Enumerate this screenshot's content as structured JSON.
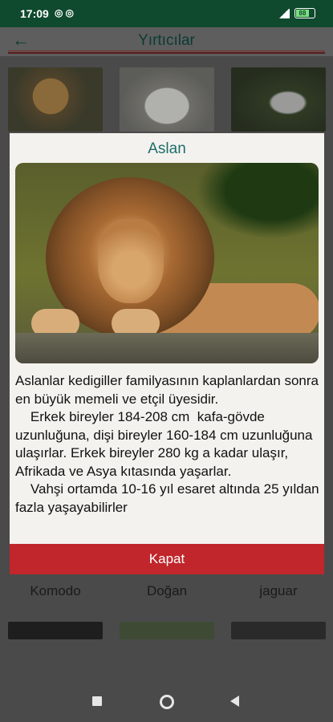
{
  "status_bar": {
    "time": "17:09",
    "notification_icons": [
      "whatsapp-icon",
      "whatsapp-icon"
    ],
    "battery": "88"
  },
  "app_bar": {
    "title": "Yırtıcılar",
    "back_icon": "arrow-left-icon"
  },
  "grid": {
    "labels": [
      "Komodo",
      "Doğan",
      "jaguar"
    ]
  },
  "dialog": {
    "title": "Aslan",
    "paragraphs": [
      "Aslanlar kedigiller familyasının kaplanlardan sonra en büyük memeli ve etçil üyesidir.",
      "    Erkek bireyler 184-208 cm  kafa-gövde uzunluğuna, dişi bireyler 160-184 cm uzunluğuna ulaşırlar. Erkek bireyler 280 kg a kadar ulaşır, Afrikada ve Asya kıtasında yaşarlar.",
      "    Vahşi ortamda 10-16 yıl esaret altında 25 yıldan fazla yaşayabilirler"
    ],
    "button_label": "Kapat"
  },
  "nav": {
    "icons": [
      "recents-icon",
      "home-icon",
      "back-icon"
    ]
  },
  "colors": {
    "status_bar": "#0f4a2e",
    "title_teal": "#1d6e6a",
    "button_red": "#c0262b"
  }
}
